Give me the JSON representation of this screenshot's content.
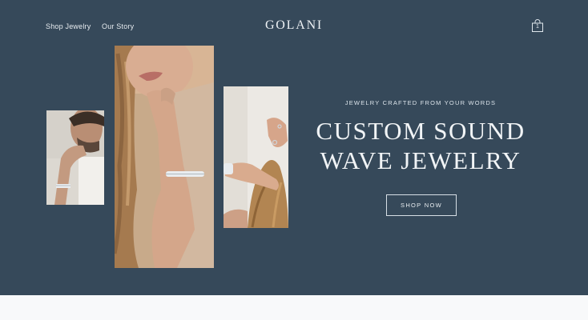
{
  "nav": {
    "links": [
      {
        "label": "Shop Jewelry"
      },
      {
        "label": "Our Story"
      }
    ],
    "logo": "GOLANI",
    "cart": {
      "count": "1",
      "icon": "shopping-bag-icon"
    }
  },
  "hero": {
    "eyebrow": "JEWELRY CRAFTED FROM YOUR WORDS",
    "headline_lines": [
      "CUSTOM SOUND",
      "WAVE JEWELRY"
    ],
    "cta_label": "SHOP NOW",
    "colors": {
      "background": "#36495a",
      "text": "#f1f4f6"
    }
  }
}
